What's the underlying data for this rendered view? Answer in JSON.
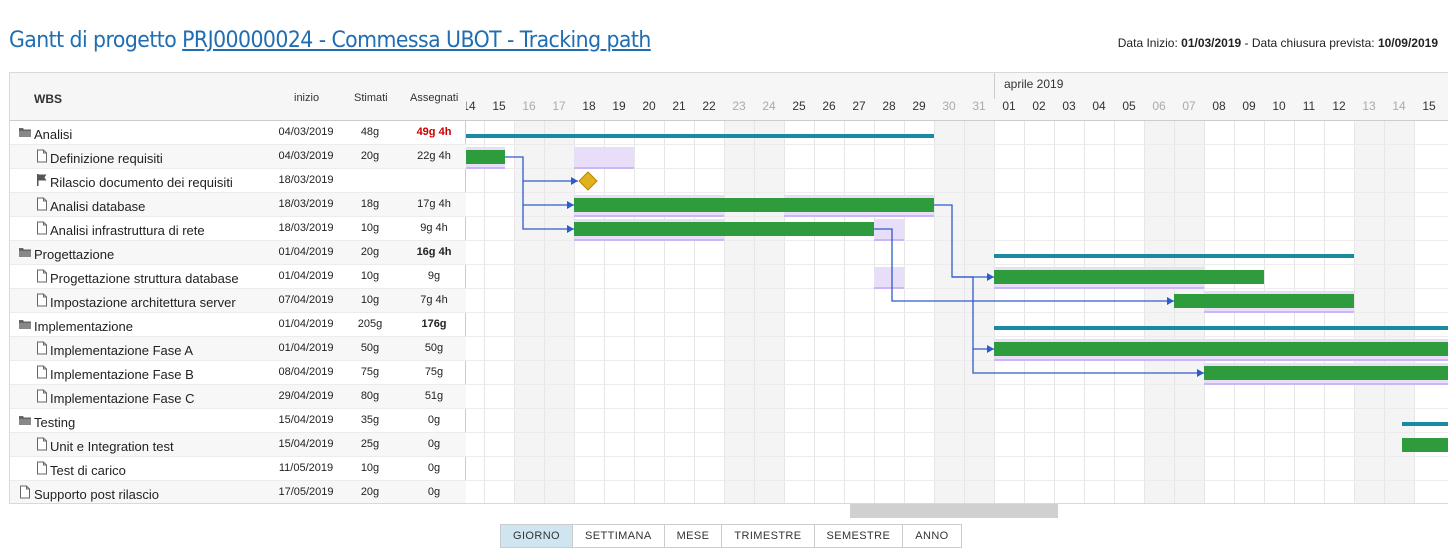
{
  "header": {
    "title_prefix": "Gantt di progetto ",
    "title_link": "PRJ00000024 - Commessa UBOT -  Tracking path",
    "start_label": "Data Inizio: ",
    "start_value": "01/03/2019",
    "sep": " - ",
    "end_label": "Data chiusura prevista: ",
    "end_value": "10/09/2019"
  },
  "columns": {
    "wbs": "WBS",
    "start": "inizio",
    "estimated": "Stimati",
    "assigned": "Assegnati"
  },
  "rows": [
    {
      "name": "Analisi",
      "start": "04/03/2019",
      "est": "48g",
      "asg": "49g 4h",
      "type": "folder",
      "asg_style": "red"
    },
    {
      "name": "Definizione requisiti",
      "start": "04/03/2019",
      "est": "20g",
      "asg": "22g 4h",
      "type": "doc"
    },
    {
      "name": "Rilascio documento dei requisiti",
      "start": "18/03/2019",
      "est": "",
      "asg": "",
      "type": "flag"
    },
    {
      "name": "Analisi database",
      "start": "18/03/2019",
      "est": "18g",
      "asg": "17g 4h",
      "type": "doc"
    },
    {
      "name": "Analisi infrastruttura di rete",
      "start": "18/03/2019",
      "est": "10g",
      "asg": "9g 4h",
      "type": "doc"
    },
    {
      "name": "Progettazione",
      "start": "01/04/2019",
      "est": "20g",
      "asg": "16g 4h",
      "type": "folder",
      "asg_style": "bold"
    },
    {
      "name": "Progettazione struttura database",
      "start": "01/04/2019",
      "est": "10g",
      "asg": "9g",
      "type": "doc"
    },
    {
      "name": "Impostazione architettura server",
      "start": "07/04/2019",
      "est": "10g",
      "asg": "7g 4h",
      "type": "doc"
    },
    {
      "name": "Implementazione",
      "start": "01/04/2019",
      "est": "205g",
      "asg": "176g",
      "type": "folder",
      "asg_style": "bold"
    },
    {
      "name": "Implementazione Fase A",
      "start": "01/04/2019",
      "est": "50g",
      "asg": "50g",
      "type": "doc"
    },
    {
      "name": "Implementazione Fase B",
      "start": "08/04/2019",
      "est": "75g",
      "asg": "75g",
      "type": "doc"
    },
    {
      "name": "Implementazione Fase C",
      "start": "29/04/2019",
      "est": "80g",
      "asg": "51g",
      "type": "doc"
    },
    {
      "name": "Testing",
      "start": "15/04/2019",
      "est": "35g",
      "asg": "0g",
      "type": "folder"
    },
    {
      "name": "Unit e Integration test",
      "start": "15/04/2019",
      "est": "25g",
      "asg": "0g",
      "type": "doc"
    },
    {
      "name": "Test di carico",
      "start": "11/05/2019",
      "est": "10g",
      "asg": "0g",
      "type": "doc"
    },
    {
      "name": "Supporto post rilascio",
      "start": "17/05/2019",
      "est": "20g",
      "asg": "0g",
      "type": "doc_root"
    }
  ],
  "timeline": {
    "month_label": "aprile 2019",
    "days": [
      "14",
      "15",
      "16",
      "17",
      "18",
      "19",
      "20",
      "21",
      "22",
      "23",
      "24",
      "25",
      "26",
      "27",
      "28",
      "29",
      "30",
      "31",
      "01",
      "02",
      "03",
      "04",
      "05",
      "06",
      "07",
      "08",
      "09",
      "10",
      "11",
      "12",
      "13",
      "14",
      "15"
    ],
    "weekend": [
      2,
      3,
      9,
      10,
      16,
      17,
      23,
      24,
      30,
      31
    ]
  },
  "zoom": {
    "options": [
      "GIORNO",
      "SETTIMANA",
      "MESE",
      "TRIMESTRE",
      "SEMESTRE",
      "ANNO"
    ],
    "active": "GIORNO"
  },
  "colors": {
    "bar": "#2e9c3c",
    "summary": "#1a8aa0",
    "planned": "#c9b8f5",
    "link": "#2e5bc9",
    "milestone": "#e0b020",
    "title": "#1f6db3"
  }
}
